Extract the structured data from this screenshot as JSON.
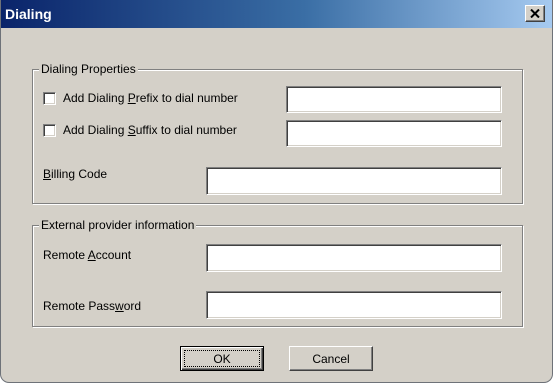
{
  "window": {
    "title": "Dialing"
  },
  "dialing_properties": {
    "group_label": "Dialing Properties",
    "prefix": {
      "label_before": "Add Dialing ",
      "mnemonic": "P",
      "label_after": "refix to dial number",
      "checked": false,
      "value": ""
    },
    "suffix": {
      "label_before": "Add Dialing ",
      "mnemonic": "S",
      "label_after": "uffix to dial number",
      "checked": false,
      "value": ""
    },
    "billing_code": {
      "label_mnemonic": "B",
      "label_after": "illing Code",
      "value": ""
    }
  },
  "external_provider": {
    "group_label": "External provider information",
    "remote_account": {
      "label_before": "Remote ",
      "mnemonic": "A",
      "label_after": "ccount",
      "value": ""
    },
    "remote_password": {
      "label_before": "Remote Pass",
      "mnemonic": "w",
      "label_after": "ord",
      "value": ""
    }
  },
  "buttons": {
    "ok_label": "OK",
    "cancel_label": "Cancel"
  }
}
